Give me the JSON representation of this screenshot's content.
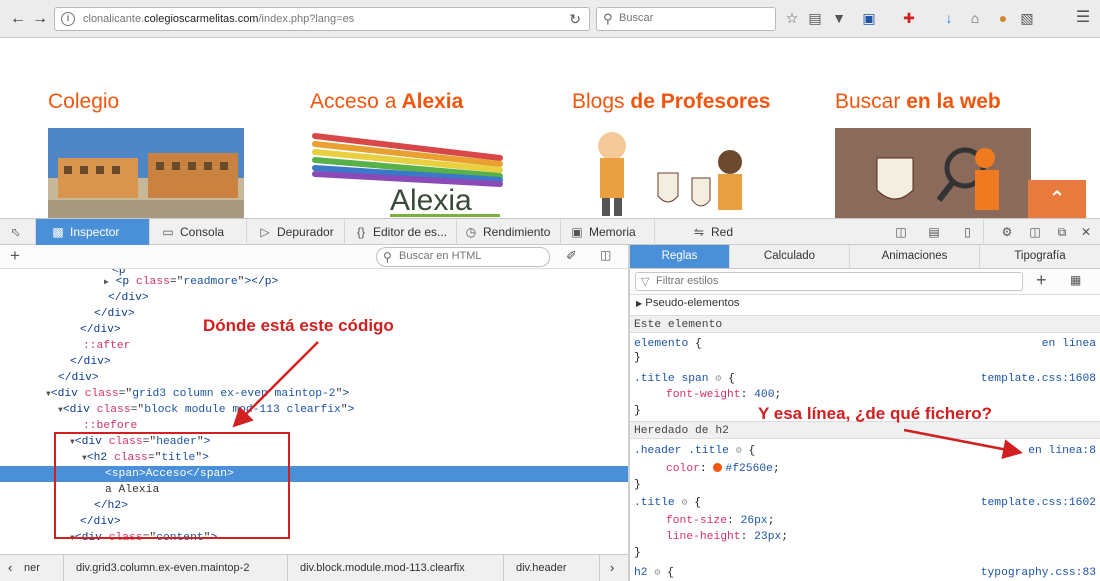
{
  "browser": {
    "url_prefix": "clonalicante.",
    "url_domain": "colegioscarmelitas.com",
    "url_path": "/index.php?lang=es",
    "search_placeholder": "Buscar"
  },
  "page": {
    "sections": [
      {
        "title_normal": "Colegio",
        "title_bold": ""
      },
      {
        "title_normal": "Acceso ",
        "title_mid": "a",
        "title_bold": " Alexia"
      },
      {
        "title_normal": "Blogs ",
        "title_bold": "de Profesores"
      },
      {
        "title_normal": "Buscar ",
        "title_bold": "en la web"
      }
    ],
    "alexia_logo_text": "Alexia"
  },
  "devtools": {
    "tabs": [
      {
        "label": "Inspector",
        "icon": "inspector-icon"
      },
      {
        "label": "Consola",
        "icon": "console-icon"
      },
      {
        "label": "Depurador",
        "icon": "debugger-icon"
      },
      {
        "label": "Editor de es...",
        "icon": "style-editor-icon"
      },
      {
        "label": "Rendimiento",
        "icon": "performance-icon"
      },
      {
        "label": "Memoria",
        "icon": "memory-icon"
      },
      {
        "label": "Red",
        "icon": "network-icon"
      }
    ],
    "html_search_placeholder": "Buscar en HTML",
    "breadcrumbs": [
      "ner",
      "div.grid3.column.ex-even.maintop-2",
      "div.block.module.mod-113.clearfix",
      "div.header"
    ],
    "rules_tabs": [
      "Reglas",
      "Calculado",
      "Animaciones",
      "Tipografía"
    ],
    "filter_placeholder": "Filtrar estilos",
    "pseudo_elements_label": "Pseudo-elementos",
    "this_element_label": "Este elemento",
    "inherited_label": "Heredado de h2",
    "rules": {
      "element_selector": "elemento",
      "element_source": "en línea",
      "r1_selector": ".title span",
      "r1_source": "template.css:1608",
      "r1_prop": "font-weight",
      "r1_val": "400",
      "r2_selector": ".header .title",
      "r2_source": "en línea:8",
      "r2_prop": "color",
      "r2_val": "#f2560e",
      "r3_selector": ".title",
      "r3_source": "template.css:1602",
      "r3_prop1": "font-size",
      "r3_val1": "26px",
      "r3_prop2": "line-height",
      "r3_val2": "23px",
      "r4_selector": "h2",
      "r4_source": "typography.css:83"
    },
    "html_lines": {
      "l1_attr": "class",
      "l1_val": "readmore",
      "l2_div_close": "</div>",
      "after": "::after",
      "before": "::before",
      "grid_class": "grid3 column ex-even maintop-2",
      "block_class": "block module mod-113 clearfix",
      "header_class": "header",
      "title_class": "title",
      "span_text": "Acceso",
      "text_node": "a Alexia",
      "content_class": "content"
    }
  },
  "annotations": {
    "code_question": "Dónde está este código",
    "file_question": "Y esa línea, ¿de qué fichero?"
  }
}
